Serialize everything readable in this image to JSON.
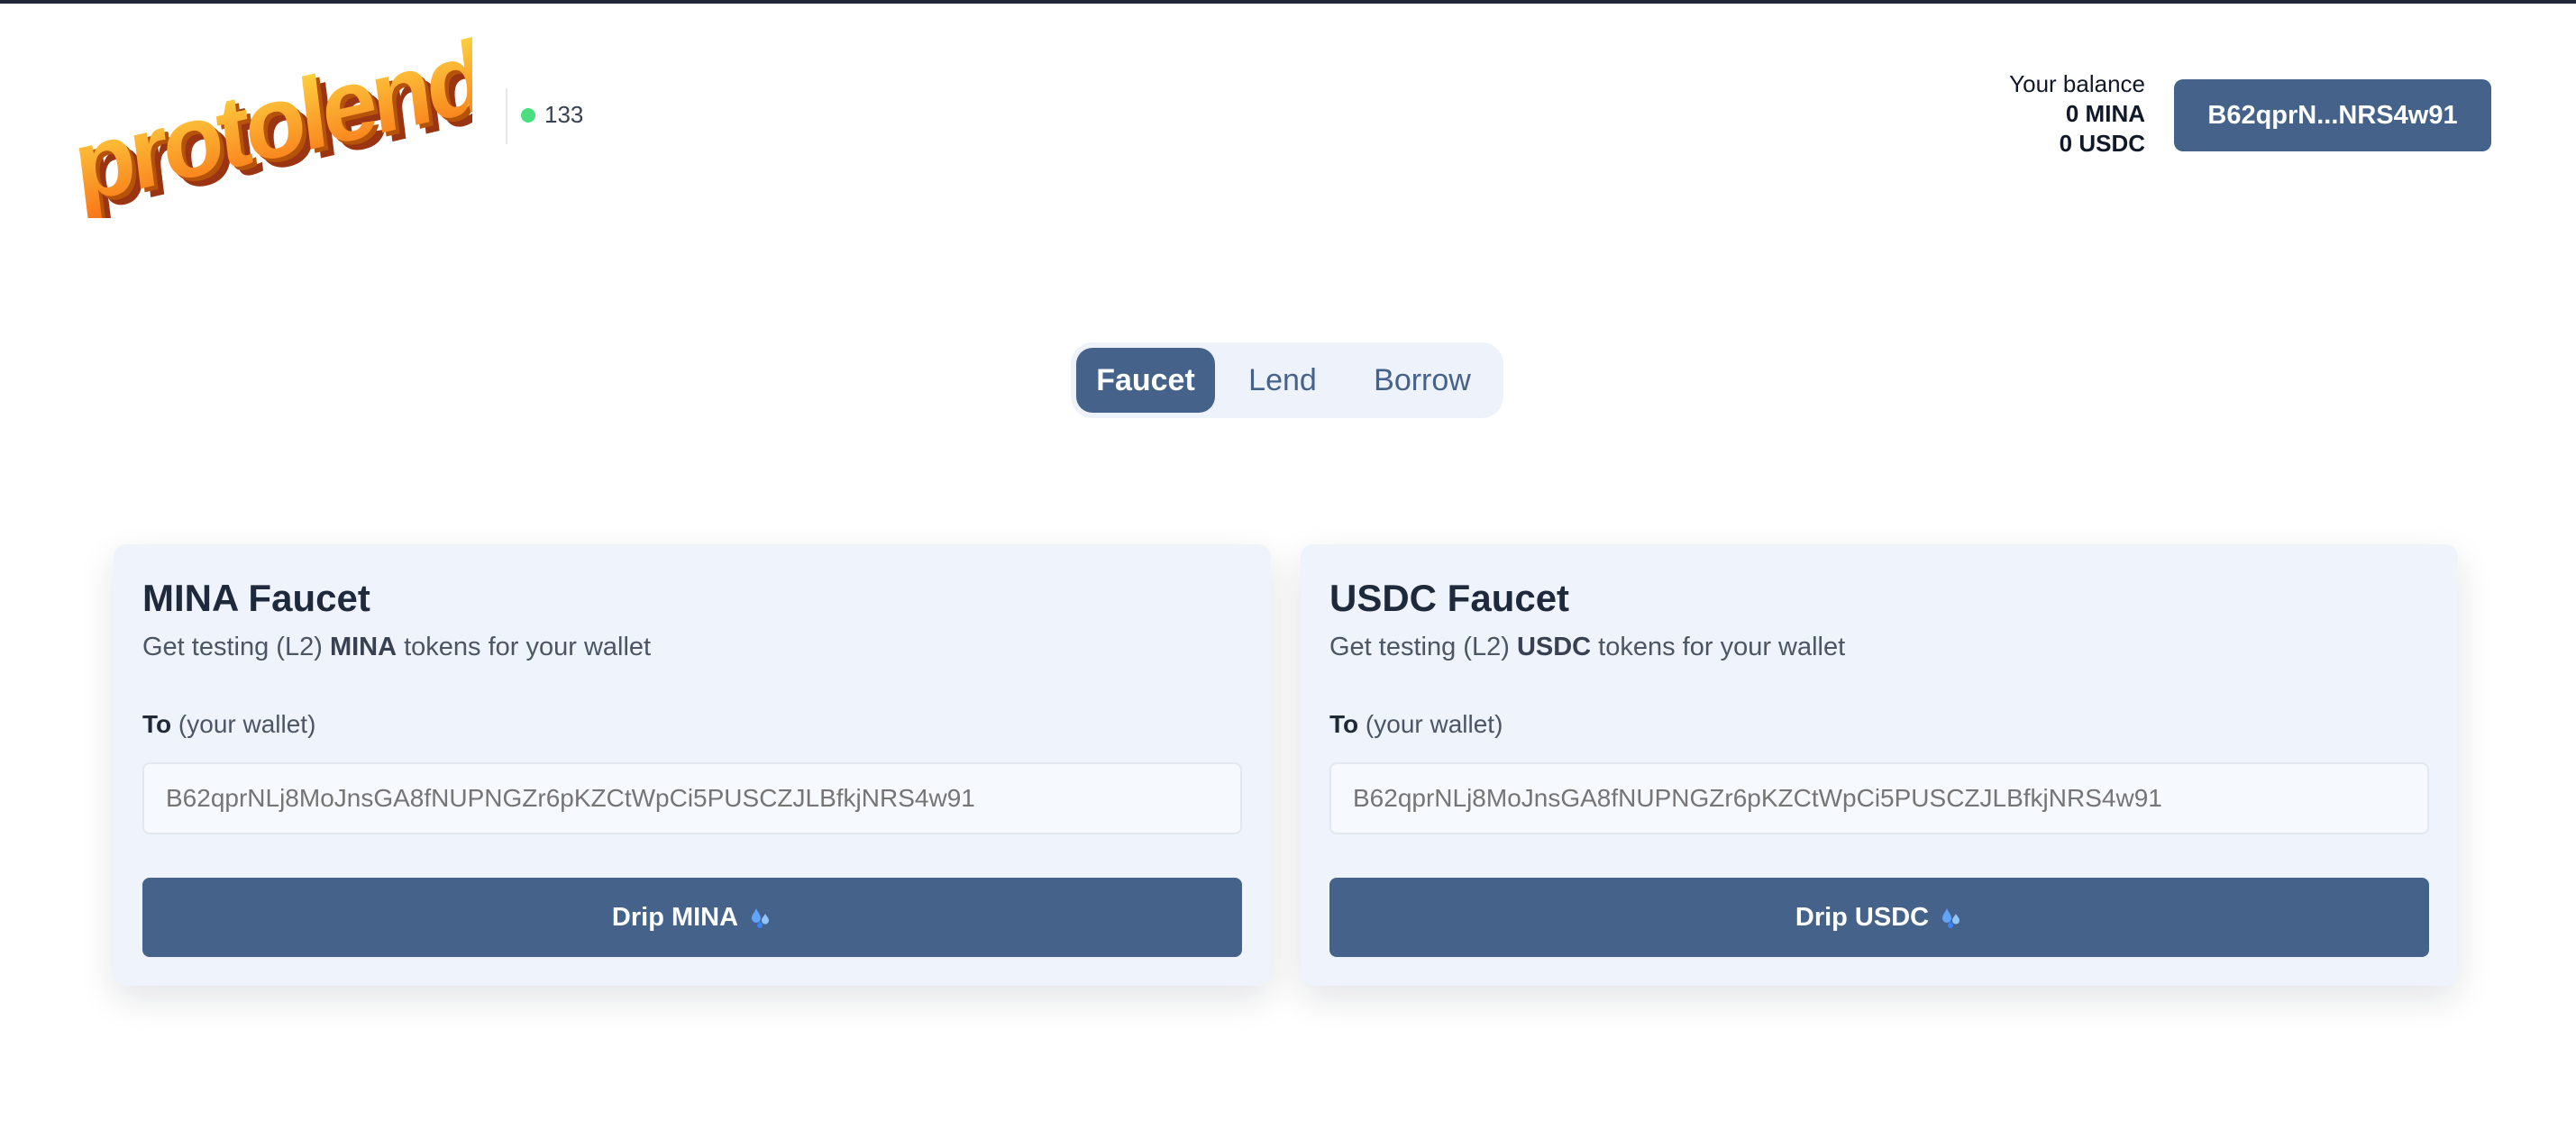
{
  "header": {
    "logo_text": "protolend",
    "block_height": "133",
    "balance_label": "Your balance",
    "balances": [
      "0 MINA",
      "0 USDC"
    ],
    "wallet_button": "B62qprN...NRS4w91"
  },
  "tabs": [
    {
      "label": "Faucet",
      "active": true
    },
    {
      "label": "Lend",
      "active": false
    },
    {
      "label": "Borrow",
      "active": false
    }
  ],
  "faucets": [
    {
      "title": "MINA Faucet",
      "subtitle_pre": "Get testing (L2) ",
      "subtitle_token": "MINA",
      "subtitle_post": " tokens for your wallet",
      "to_label": "To",
      "to_hint": "(your wallet)",
      "address_placeholder": "B62qprNLj8MoJnsGA8fNUPNGZr6pKZCtWpCi5PUSCZJLBfkjNRS4w91",
      "button_label": "Drip MINA",
      "button_icon": "droplets-icon"
    },
    {
      "title": "USDC Faucet",
      "subtitle_pre": "Get testing (L2) ",
      "subtitle_token": "USDC",
      "subtitle_post": " tokens for your wallet",
      "to_label": "To",
      "to_hint": "(your wallet)",
      "address_placeholder": "B62qprNLj8MoJnsGA8fNUPNGZr6pKZCtWpCi5PUSCZJLBfkjNRS4w91",
      "button_label": "Drip USDC",
      "button_icon": "droplets-icon"
    }
  ],
  "colors": {
    "primary": "#45628a",
    "card_bg": "#eef3fc",
    "status_green": "#4ade80"
  }
}
